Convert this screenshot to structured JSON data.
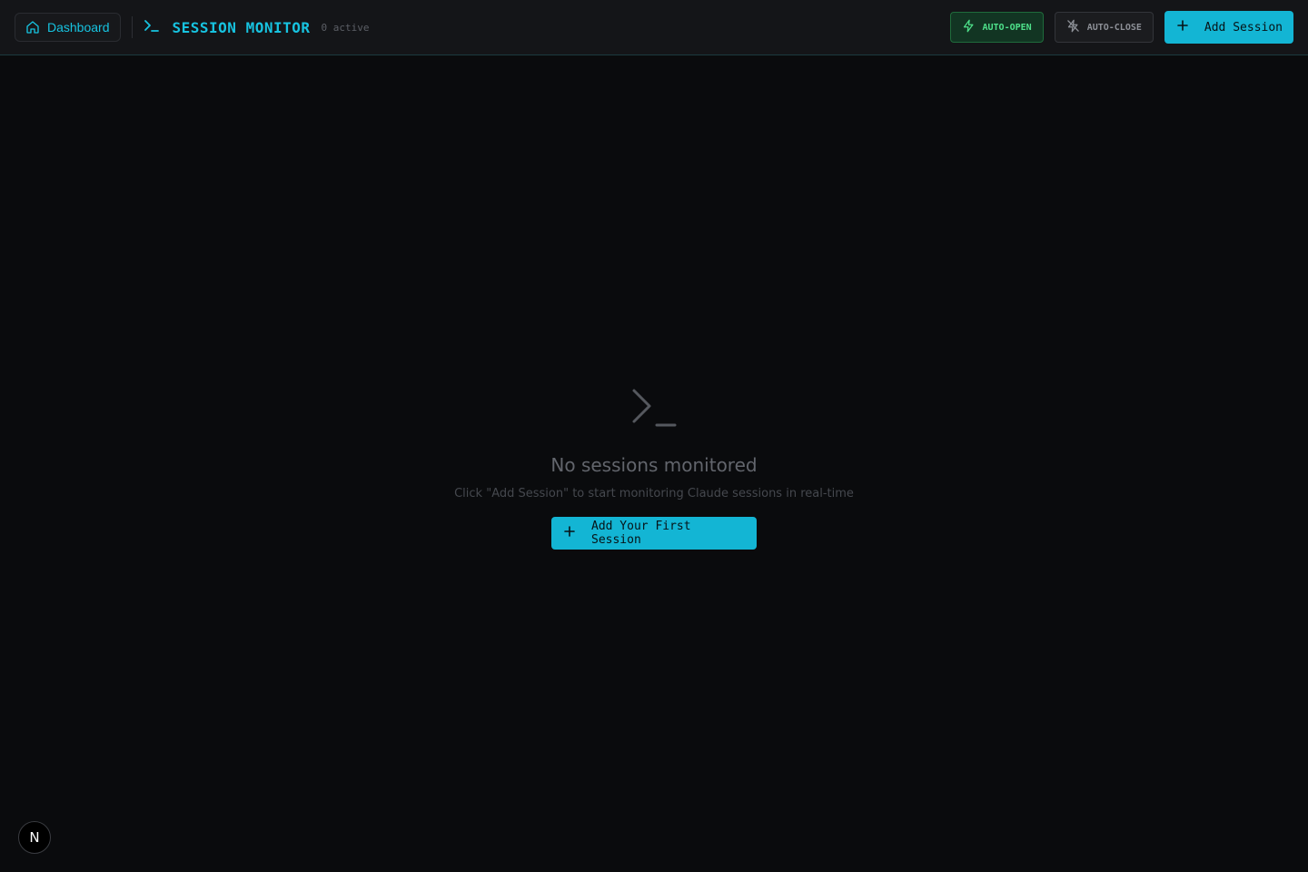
{
  "header": {
    "dashboard_label": "Dashboard",
    "title": "SESSION MONITOR",
    "active_count": "0 active",
    "auto_open_label": "AUTO-OPEN",
    "auto_close_label": "AUTO-CLOSE",
    "add_session_label": "Add Session"
  },
  "toggles": {
    "auto_open_enabled": true,
    "auto_close_enabled": false
  },
  "empty_state": {
    "title": "No sessions monitored",
    "subtitle": "Click \"Add Session\" to start monitoring Claude sessions in real-time",
    "button_label": "Add Your First Session"
  },
  "floating_badge": {
    "letter": "N"
  },
  "icons": {
    "home": "home-icon",
    "terminal": "terminal-icon",
    "bolt": "bolt-icon",
    "bolt_off": "bolt-off-icon",
    "plus": "plus-icon"
  },
  "colors": {
    "accent": "#13b5d4",
    "auto_open_green": "#4ee08a",
    "background": "#0a0b0d"
  }
}
